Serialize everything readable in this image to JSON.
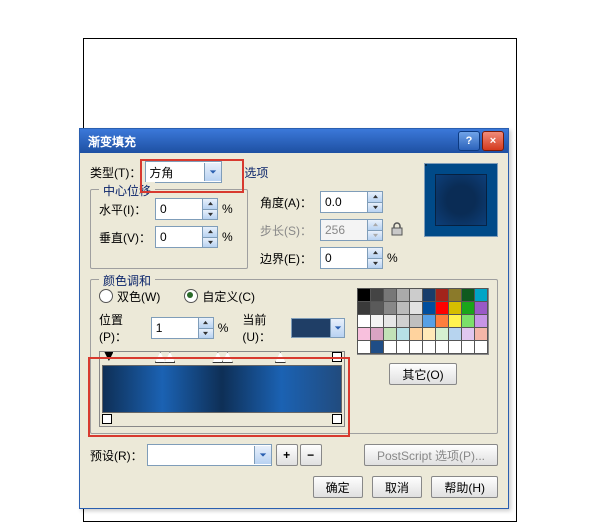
{
  "title": "渐变填充",
  "type_label": "类型(T)：",
  "type_value": "方角",
  "options_label": "选项",
  "center_group": "中心位移",
  "horiz_label": "水平(I)：",
  "horiz_value": "0",
  "vert_label": "垂直(V)：",
  "vert_value": "0",
  "angle_label": "角度(A)：",
  "angle_value": "0.0",
  "steps_label": "步长(S)：",
  "steps_value": "256",
  "edge_label": "边界(E)：",
  "edge_value": "0",
  "blend_group": "颜色调和",
  "two_label": "双色(W)",
  "custom_label": "自定义(C)",
  "pos_label": "位置(P)：",
  "pos_value": "1",
  "current_label": "当前(U)：",
  "other_btn": "其它(O)",
  "preset_label": "预设(R)：",
  "postscript_btn": "PostScript 选项(P)...",
  "ok": "确定",
  "cancel": "取消",
  "help": "帮助(H)",
  "pct": "%",
  "current_color": "#1f3e66",
  "palette": [
    "#000",
    "#444",
    "#777",
    "#aaa",
    "#ccc",
    "#183d6b",
    "#a2241b",
    "#8b7a2a",
    "#0f5a1f",
    "#00a5c6",
    "#3a3a3a",
    "#5a5a5a",
    "#888",
    "#bbb",
    "#e2e2e2",
    "#004e9e",
    "#ff0000",
    "#d5be00",
    "#1aa51a",
    "#9a59c7",
    "#fff",
    "#f4f4f4",
    "#e7e7e7",
    "#d0d0d0",
    "#bfbfbf",
    "#56a0e6",
    "#ff7e3e",
    "#fff34f",
    "#7be06a",
    "#c695e6",
    "#f8c0dd",
    "#d9a4c3",
    "#c2e2b7",
    "#b7e0e6",
    "#ffd39e",
    "#ffe9b8",
    "#d5f0d0",
    "#b7d4ef",
    "#e0c7ef",
    "#f4b6a8",
    "#fff",
    "#1f4d86",
    "#fff",
    "#fff",
    "#fff",
    "#fff",
    "#fff",
    "#fff",
    "#fff",
    "#fff"
  ]
}
